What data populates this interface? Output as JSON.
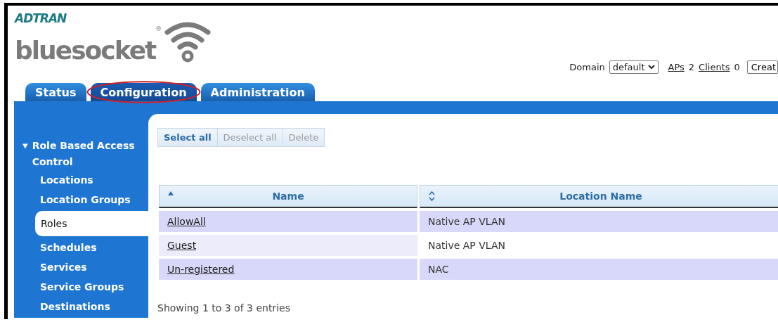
{
  "header": {
    "brand": "ADTRAN",
    "product": "bluesocket",
    "registered": "®",
    "domain": {
      "label": "Domain",
      "value": "default"
    },
    "aps": {
      "label": "APs",
      "count": "2"
    },
    "clients": {
      "label": "Clients",
      "count": "0"
    },
    "create_button": "Creat"
  },
  "tabs": [
    {
      "label": "Status",
      "selected": false,
      "circled": false
    },
    {
      "label": "Configuration",
      "selected": true,
      "circled": true
    },
    {
      "label": "Administration",
      "selected": false,
      "circled": false
    }
  ],
  "sidebar": {
    "section": {
      "label": "Role Based Access Control",
      "expanded": true
    },
    "items": [
      {
        "label": "Locations",
        "selected": false
      },
      {
        "label": "Location Groups",
        "selected": false
      },
      {
        "label": "Roles",
        "selected": true
      },
      {
        "label": "Schedules",
        "selected": false
      },
      {
        "label": "Services",
        "selected": false
      },
      {
        "label": "Service Groups",
        "selected": false
      },
      {
        "label": "Destinations",
        "selected": false
      }
    ]
  },
  "toolbar": [
    {
      "label": "Select all",
      "disabled": false
    },
    {
      "label": "Deselect all",
      "disabled": true
    },
    {
      "label": "Delete",
      "disabled": true
    }
  ],
  "table": {
    "columns": [
      {
        "label": "Name",
        "sorted": true
      },
      {
        "label": "Location Name",
        "sorted": false
      }
    ],
    "rows": [
      [
        "AllowAll",
        "Native AP VLAN"
      ],
      [
        "Guest",
        "Native AP VLAN"
      ],
      [
        "Un-registered",
        "NAC"
      ]
    ]
  },
  "footer": "Showing 1 to 3 of 3 entries"
}
